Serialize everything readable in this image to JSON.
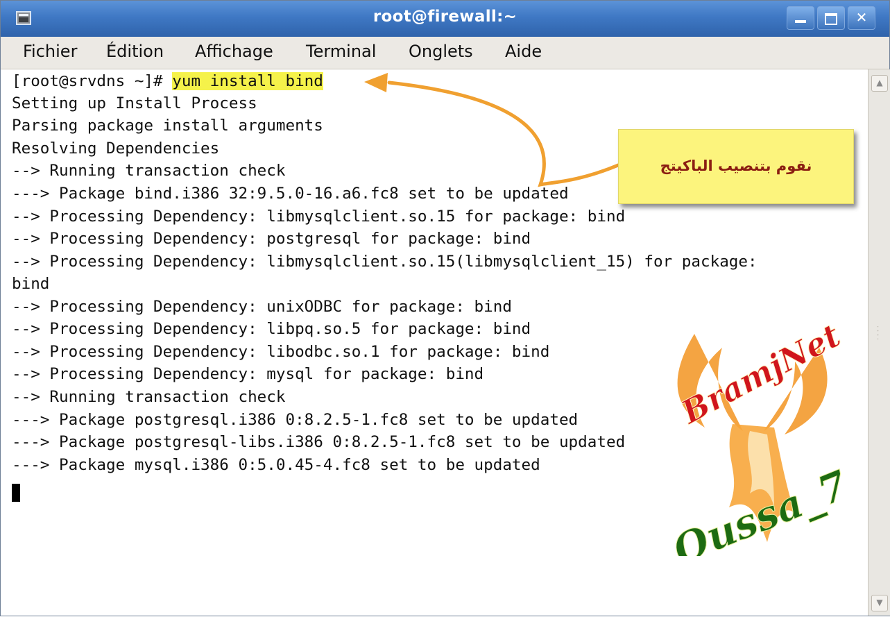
{
  "window": {
    "title": "root@firewall:~"
  },
  "menubar": {
    "items": [
      "Fichier",
      "Édition",
      "Affichage",
      "Terminal",
      "Onglets",
      "Aide"
    ]
  },
  "terminal": {
    "prompt": "[root@srvdns ~]# ",
    "command": "yum install bind",
    "lines": [
      "Setting up Install Process",
      "Parsing package install arguments",
      "Resolving Dependencies",
      "--> Running transaction check",
      "---> Package bind.i386 32:9.5.0-16.a6.fc8 set to be updated",
      "--> Processing Dependency: libmysqlclient.so.15 for package: bind",
      "--> Processing Dependency: postgresql for package: bind",
      "--> Processing Dependency: libmysqlclient.so.15(libmysqlclient_15) for package:",
      "bind",
      "--> Processing Dependency: unixODBC for package: bind",
      "--> Processing Dependency: libpq.so.5 for package: bind",
      "--> Processing Dependency: libodbc.so.1 for package: bind",
      "--> Processing Dependency: mysql for package: bind",
      "--> Running transaction check",
      "---> Package postgresql.i386 0:8.2.5-1.fc8 set to be updated",
      "---> Package postgresql-libs.i386 0:8.2.5-1.fc8 set to be updated",
      "---> Package mysql.i386 0:5.0.45-4.fc8 set to be updated"
    ]
  },
  "annotation": {
    "note_text": "نقوم بتنصيب الباكيتج",
    "highlight_color": "#f5f24a",
    "arrow_color": "#f0a030"
  },
  "watermark": {
    "top_text": "BramjNet",
    "bottom_text": "Oussa_7"
  }
}
